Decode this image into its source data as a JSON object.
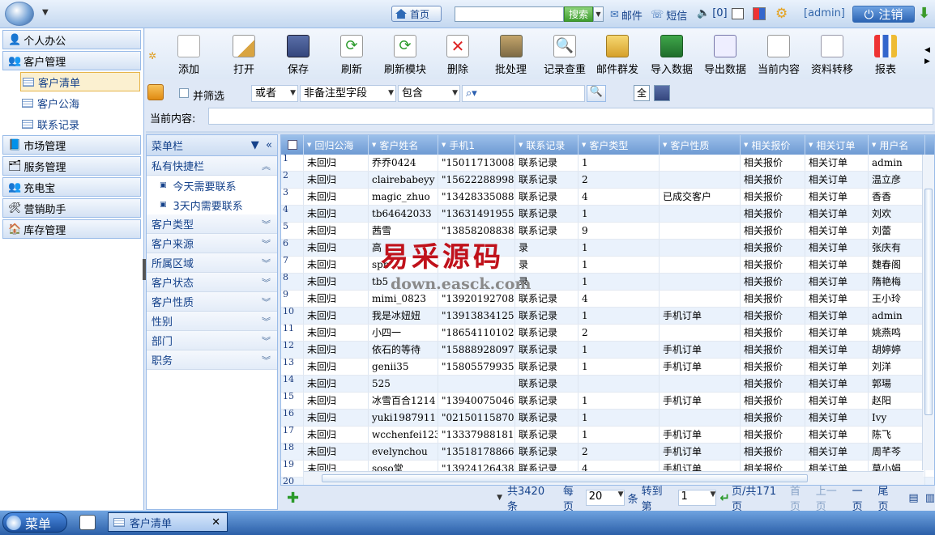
{
  "topbar": {
    "home": "首页",
    "search_btn": "搜索",
    "mail": "邮件",
    "sms": "短信",
    "msg_count": "[0]",
    "admin": "[admin]",
    "logout": "注销"
  },
  "leftnav": {
    "items": [
      {
        "label": "个人办公"
      },
      {
        "label": "客户管理"
      },
      {
        "label": "客户清单"
      },
      {
        "label": "客户公海"
      },
      {
        "label": "联系记录"
      },
      {
        "label": "市场管理"
      },
      {
        "label": "服务管理"
      },
      {
        "label": "充电宝"
      },
      {
        "label": "营销助手"
      },
      {
        "label": "库存管理"
      }
    ]
  },
  "toolbar": [
    "添加",
    "打开",
    "保存",
    "刷新",
    "刷新模块",
    "删除",
    "批处理",
    "记录查重",
    "邮件群发",
    "导入数据",
    "导出数据",
    "当前内容",
    "资料转移",
    "报表"
  ],
  "filter": {
    "and_filter": "并筛选",
    "logic": "或者",
    "field": "非备注型字段",
    "op": "包含",
    "all": "全"
  },
  "current": {
    "label": "当前内容:"
  },
  "midpanel": {
    "title": "菜单栏",
    "items": [
      "私有快捷栏",
      "今天需要联系",
      "3天内需要联系",
      "客户类型",
      "客户来源",
      "所属区域",
      "客户状态",
      "客户性质",
      "性别",
      "部门",
      "职务"
    ]
  },
  "grid": {
    "headers": [
      "回归公海",
      "客户姓名",
      "手机1",
      "联系记录",
      "客户类型",
      "客户性质",
      "相关报价",
      "相关订单",
      "用户名"
    ],
    "rows": [
      [
        "1",
        "未回归",
        "乔乔0424",
        "\"15011713008",
        "联系记录",
        "1",
        "",
        "相关报价",
        "相关订单",
        "admin"
      ],
      [
        "2",
        "未回归",
        "clairebabeyy",
        "\"15622288998",
        "联系记录",
        "2",
        "",
        "相关报价",
        "相关订单",
        "温立彦"
      ],
      [
        "3",
        "未回归",
        "magic_zhuo",
        "\"13428335088",
        "联系记录",
        "4",
        "已成交客户",
        "相关报价",
        "相关订单",
        "香香"
      ],
      [
        "4",
        "未回归",
        "tb64642033",
        "\"13631491955",
        "联系记录",
        "1",
        "",
        "相关报价",
        "相关订单",
        "刘欢"
      ],
      [
        "5",
        "未回归",
        "茜雪",
        "\"13858208838",
        "联系记录",
        "9",
        "",
        "相关报价",
        "相关订单",
        "刘蕾"
      ],
      [
        "6",
        "未回归",
        "高",
        "",
        "录",
        "1",
        "",
        "相关报价",
        "相关订单",
        "张庆有"
      ],
      [
        "7",
        "未回归",
        "spb",
        "",
        "录",
        "1",
        "",
        "相关报价",
        "相关订单",
        "魏春阁"
      ],
      [
        "8",
        "未回归",
        "tb5",
        "",
        "录",
        "1",
        "",
        "相关报价",
        "相关订单",
        "隋艳梅"
      ],
      [
        "9",
        "未回归",
        "mimi_0823",
        "\"13920192708",
        "联系记录",
        "4",
        "",
        "相关报价",
        "相关订单",
        "王小玲"
      ],
      [
        "10",
        "未回归",
        "我是冰妞妞",
        "\"13913834125",
        "联系记录",
        "1",
        "手机订单",
        "相关报价",
        "相关订单",
        "admin"
      ],
      [
        "11",
        "未回归",
        "小四一",
        "\"18654110102",
        "联系记录",
        "2",
        "",
        "相关报价",
        "相关订单",
        "姚燕鸣"
      ],
      [
        "12",
        "未回归",
        "依石的等待",
        "\"15888928097",
        "联系记录",
        "1",
        "手机订单",
        "相关报价",
        "相关订单",
        "胡婷婷"
      ],
      [
        "13",
        "未回归",
        "genii35",
        "\"15805579935",
        "联系记录",
        "1",
        "手机订单",
        "相关报价",
        "相关订单",
        "刘洋"
      ],
      [
        "14",
        "未回归",
        "525",
        "",
        "联系记录",
        "",
        "",
        "相关报价",
        "相关订单",
        "郭瑒"
      ],
      [
        "15",
        "未回归",
        "冰雪百合1214",
        "\"13940075046",
        "联系记录",
        "1",
        "手机订单",
        "相关报价",
        "相关订单",
        "赵阳"
      ],
      [
        "16",
        "未回归",
        "yuki1987911",
        "\"02150115870",
        "联系记录",
        "1",
        "",
        "相关报价",
        "相关订单",
        "Ivy"
      ],
      [
        "17",
        "未回归",
        "wcchenfei123",
        "\"13337988181",
        "联系记录",
        "1",
        "手机订单",
        "相关报价",
        "相关订单",
        "陈飞"
      ],
      [
        "18",
        "未回归",
        "evelynchou",
        "\"13518178866",
        "联系记录",
        "2",
        "手机订单",
        "相关报价",
        "相关订单",
        "周芊芩"
      ],
      [
        "19",
        "未回归",
        "soso堂",
        "\"13924126438",
        "联系记录",
        "4",
        "手机订单",
        "相关报价",
        "相关订单",
        "莫小娟"
      ],
      [
        "20",
        "",
        "",
        "",
        "",
        "",
        "",
        "",
        "",
        ""
      ]
    ]
  },
  "pager": {
    "total": "共3420条",
    "per_label": "每页",
    "per": "20",
    "unit": "条",
    "goto": "转到 第",
    "page": "1",
    "pages": "页/共171页",
    "first": "首页",
    "prev": "上一页",
    "next": "一页",
    "last": "尾页"
  },
  "watermark": {
    "cn": "易采源码",
    "url": "down.easck.com"
  },
  "taskbar": {
    "menu": "菜单",
    "tab": "客户清单"
  }
}
